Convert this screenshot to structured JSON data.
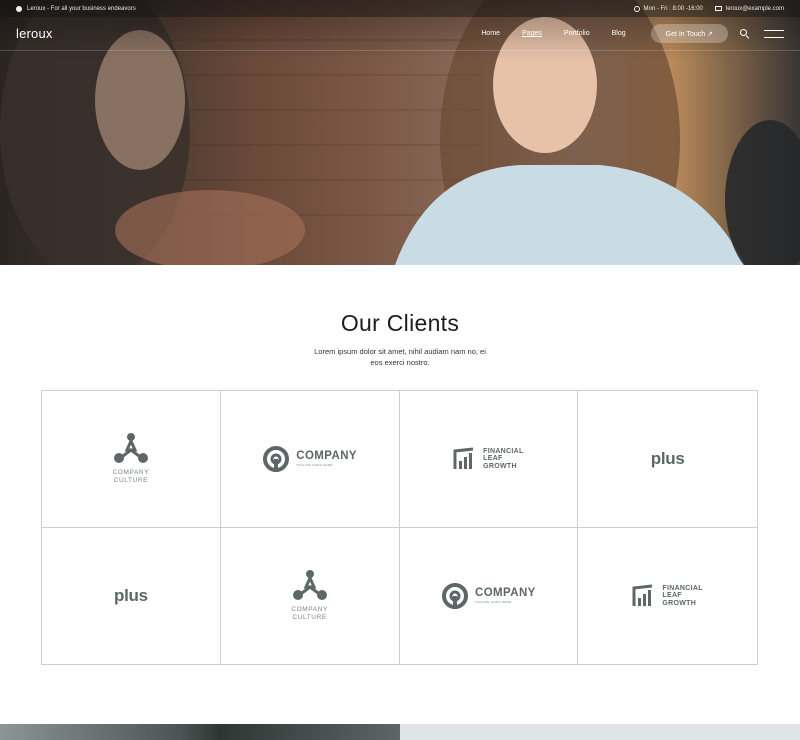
{
  "topbar": {
    "tagline": "Leroux - For all your business endeavors",
    "hours": "Mon - Fri : 8:00 -16:00",
    "email": "leroux@example.com"
  },
  "nav": {
    "logo": "leroux",
    "items": [
      {
        "label": "Home"
      },
      {
        "label": "Pages"
      },
      {
        "label": "Portfolio"
      },
      {
        "label": "Blog"
      }
    ],
    "cta_label": "Get In Touch ↗"
  },
  "clients": {
    "title": "Our Clients",
    "subtitle": "Lorem ipsum dolor sit amet, nihil audiam nam no, ei eos exerci nostro."
  },
  "logos": {
    "company_culture": [
      "COMPANY",
      "CULTURE"
    ],
    "company": "COMPANY",
    "company_tagline": "TAGLINE GOES HERE",
    "financial": [
      "FINANCIAL",
      "LEAF",
      "GROWTH"
    ],
    "plus": "plus"
  },
  "colors": {
    "logo_gray": "#5d6767",
    "grid_border": "#cfcfcf"
  },
  "icons": [
    "chat-icon",
    "clock-icon",
    "mail-icon",
    "search-icon",
    "hamburger-icon",
    "arrow-up-right-icon"
  ]
}
